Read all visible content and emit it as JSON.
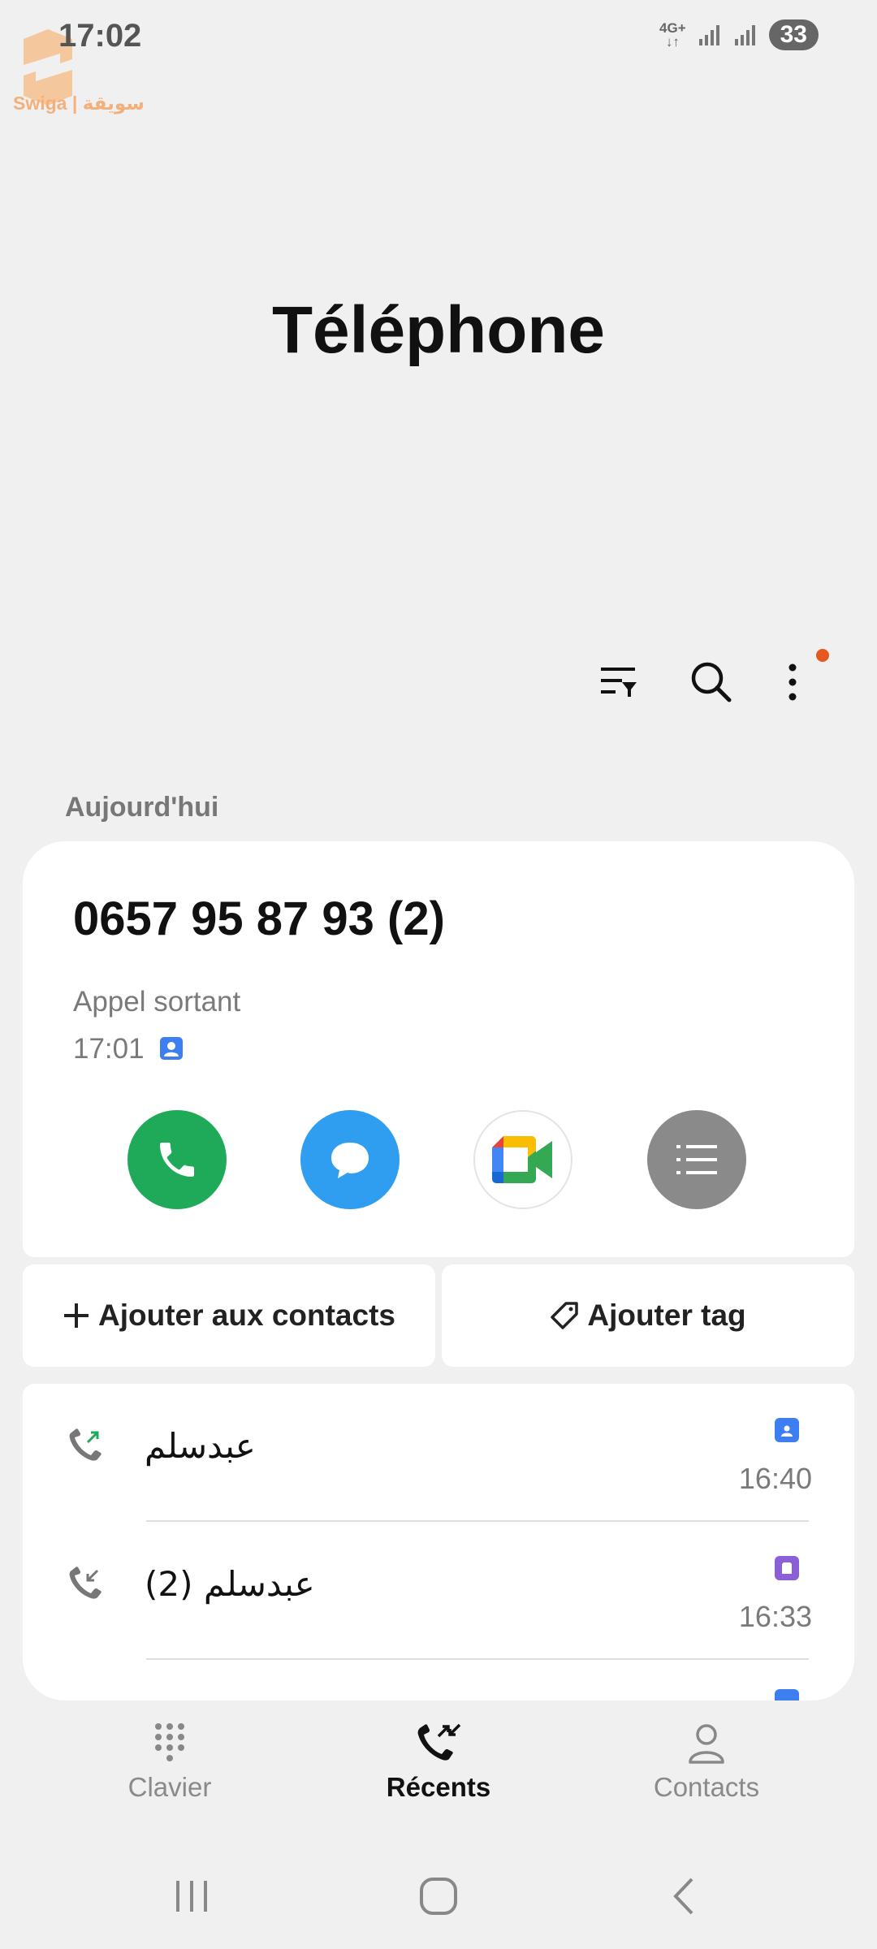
{
  "status_bar": {
    "time": "17:02",
    "network": "4G+",
    "battery": "33"
  },
  "watermark": {
    "text": "Swiga | سويقة"
  },
  "title": "Téléphone",
  "toolbar": {
    "filter_icon": "filter-icon",
    "search_icon": "search-icon",
    "more_icon": "more-icon"
  },
  "section": {
    "label": "Aujourd'hui"
  },
  "detail": {
    "number": "0657 95 87 93 (2)",
    "call_type": "Appel sortant",
    "time": "17:01",
    "actions": [
      "call-icon",
      "message-icon",
      "meet-video-icon",
      "details-icon"
    ]
  },
  "buttons": {
    "add_contact": "Ajouter aux contacts",
    "add_tag": "Ajouter tag"
  },
  "calls": [
    {
      "name": "عبدسلم",
      "time": "16:40",
      "direction": "outgoing",
      "sim_color": "#3d7ff0"
    },
    {
      "name": "عبدسلم (2)",
      "time": "16:33",
      "direction": "incoming",
      "sim_color": "#8b5fd6"
    }
  ],
  "nav": {
    "keypad": "Clavier",
    "recents": "Récents",
    "contacts": "Contacts",
    "active": "recents"
  },
  "colors": {
    "call": "#1faa5a",
    "message": "#2f9df0",
    "details": "#8a8a8a",
    "notif_dot": "#e8571f",
    "outgoing_arrow": "#1faa5a"
  }
}
